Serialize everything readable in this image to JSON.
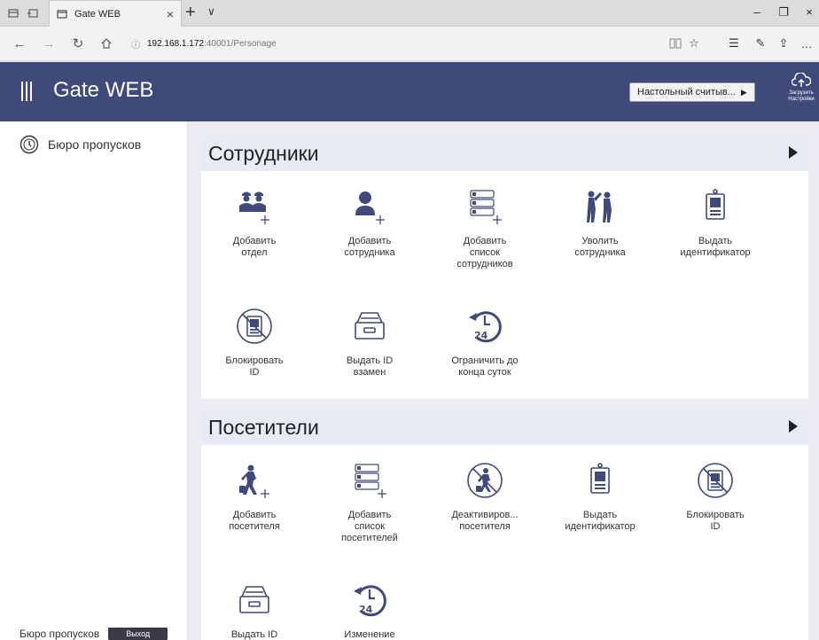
{
  "browser": {
    "tab_title": "Gate WEB",
    "url_host": "192.168.1.172",
    "url_path": ":40001/Personage",
    "colors": {
      "tabbar": "#dcdcdc",
      "addrbar": "#f2f2f2"
    }
  },
  "app": {
    "title": "Gate WEB",
    "reader_label": "Настольный считыв...",
    "upload_label_1": "Загрузить",
    "upload_label_2": "Настройки",
    "colors": {
      "header": "#3f4a7a",
      "section_head": "#e8ebf6",
      "icon": "#3f4a7a"
    }
  },
  "sidebar": {
    "items": [
      {
        "label": "Бюро пропусков",
        "icon": "clock-icon"
      }
    ],
    "footer_label": "Бюро пропусков",
    "logout_label": "Выход"
  },
  "sections": [
    {
      "title": "Сотрудники",
      "tiles": [
        {
          "label": "Добавить\nотдел",
          "icon": "add-department-icon"
        },
        {
          "label": "Добавить\nсотрудника",
          "icon": "add-employee-icon"
        },
        {
          "label": "Добавить\nсписок\nсотрудников",
          "icon": "add-employee-list-icon"
        },
        {
          "label": "Уволить\nсотрудника",
          "icon": "dismiss-employee-icon"
        },
        {
          "label": "Выдать\nидентификатор",
          "icon": "issue-id-icon"
        },
        {
          "label": "Блокировать\nID",
          "icon": "block-id-icon"
        },
        {
          "label": "Выдать ID\nвзамен",
          "icon": "replacement-id-icon"
        },
        {
          "label": "Ограничить до\nконца суток",
          "icon": "limit-24h-icon"
        }
      ]
    },
    {
      "title": "Посетители",
      "tiles": [
        {
          "label": "Добавить\nпосетителя",
          "icon": "add-visitor-icon"
        },
        {
          "label": "Добавить\nсписок\nпосетителей",
          "icon": "add-visitor-list-icon"
        },
        {
          "label": "Деактивиров...\nпосетителя",
          "icon": "deactivate-visitor-icon"
        },
        {
          "label": "Выдать\nидентификатор",
          "icon": "issue-id-icon"
        },
        {
          "label": "Блокировать\nID",
          "icon": "block-id-icon"
        },
        {
          "label": "Выдать ID",
          "icon": "replacement-id-icon"
        },
        {
          "label": "Изменение",
          "icon": "change-24h-icon"
        }
      ]
    }
  ]
}
